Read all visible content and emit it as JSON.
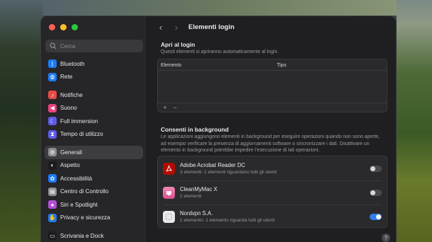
{
  "window": {
    "title": "Elementi login"
  },
  "sidebar": {
    "search_placeholder": "Cerca",
    "groups": [
      [
        {
          "label": "Bluetooth",
          "icon": "bluetooth-icon",
          "color": "#1a7cf5"
        },
        {
          "label": "Rete",
          "icon": "globe-icon",
          "color": "#1a7cf5"
        }
      ],
      [
        {
          "label": "Notifiche",
          "icon": "bell-icon",
          "color": "#ea4a45"
        },
        {
          "label": "Suono",
          "icon": "speaker-icon",
          "color": "#e9427d"
        },
        {
          "label": "Full immersion",
          "icon": "moon-icon",
          "color": "#5e5ce6"
        },
        {
          "label": "Tempo di utilizzo",
          "icon": "hourglass-icon",
          "color": "#5e5ce6"
        }
      ],
      [
        {
          "label": "Generali",
          "icon": "gear-icon",
          "color": "#8e8e93",
          "active": true
        },
        {
          "label": "Aspetto",
          "icon": "appearance-icon",
          "color": "#1c1c1e"
        },
        {
          "label": "Accessibilità",
          "icon": "accessibility-icon",
          "color": "#1a7cf5"
        },
        {
          "label": "Centro di Controllo",
          "icon": "control-center-icon",
          "color": "#8e8e93"
        },
        {
          "label": "Siri e Spotlight",
          "icon": "siri-icon",
          "color": "#b34fd8"
        },
        {
          "label": "Privacy e sicurezza",
          "icon": "hand-icon",
          "color": "#1a7cf5"
        }
      ],
      [
        {
          "label": "Scrivania e Dock",
          "icon": "dock-icon",
          "color": "#1c1c1e"
        }
      ]
    ]
  },
  "open_at_login": {
    "title": "Apri al login",
    "description": "Questi elementi si apriranno automaticamente al login.",
    "columns": [
      "Elemento",
      "Tipo"
    ],
    "add_label": "+",
    "remove_label": "−"
  },
  "background": {
    "title": "Consenti in background",
    "description": "Le applicazioni aggiungono elementi in background per eseguire operazioni quando non sono aperte, ad esempio verificare la presenza di aggiornamenti software o sincronizzare i dati. Disattivare un elemento in background potrebbe impedire l'esecuzione di tali operazioni.",
    "items": [
      {
        "name": "Adobe Acrobat Reader DC",
        "detail": "3 elementi: 2 elementi riguardano tutti gli utenti",
        "icon": "acrobat-icon",
        "enabled": false
      },
      {
        "name": "CleanMyMac X",
        "detail": "2 elementi",
        "icon": "cleanmymac-icon",
        "enabled": false
      },
      {
        "name": "Nordvpn S.A.",
        "detail": "1 elemento: 1 elemento riguarda tutti gli utenti",
        "icon": "generic-app-icon",
        "enabled": true
      }
    ]
  },
  "help_label": "?",
  "colors": {
    "accent": "#2f7ff0",
    "window_bg": "#1f1f21",
    "sidebar_bg": "#262527"
  }
}
